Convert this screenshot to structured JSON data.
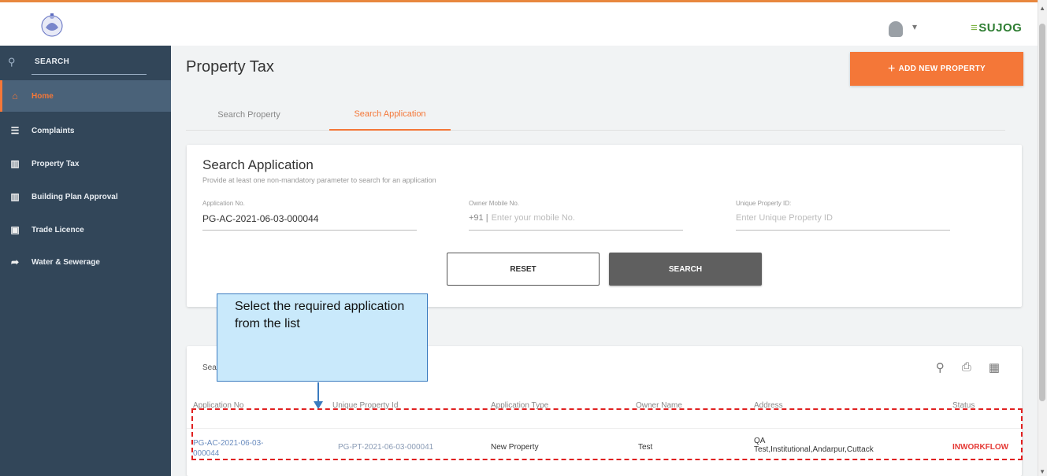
{
  "topbar": {
    "brand_prefix": "≡",
    "brand": "SUJOG",
    "user_caret": "▾",
    "logo_icon": "state-emblem-icon",
    "avatar_icon": "user-avatar-icon"
  },
  "sidebar": {
    "search_label": "SEARCH",
    "search_icon": "search-icon",
    "items": [
      {
        "label": "Home",
        "icon": "home-icon",
        "glyph": "⌂",
        "active": true
      },
      {
        "label": "Complaints",
        "icon": "complaints-icon",
        "glyph": "☰",
        "active": false
      },
      {
        "label": "Property Tax",
        "icon": "property-tax-icon",
        "glyph": "▥",
        "active": false
      },
      {
        "label": "Building Plan Approval",
        "icon": "building-icon",
        "glyph": "▥",
        "active": false
      },
      {
        "label": "Trade Licence",
        "icon": "trade-licence-icon",
        "glyph": "▣",
        "active": false
      },
      {
        "label": "Water & Sewerage",
        "icon": "water-icon",
        "glyph": "➦",
        "active": false
      }
    ],
    "colors": {
      "background": "#324659",
      "active": "#f47738"
    }
  },
  "main": {
    "title": "Property Tax",
    "add_button": "ADD NEW PROPERTY",
    "tabs": [
      {
        "label": "Search Property",
        "active": false
      },
      {
        "label": "Search Application",
        "active": true
      }
    ]
  },
  "search_card": {
    "title": "Search Application",
    "subtitle": "Provide at least one non-mandatory parameter to search for an application",
    "fields": {
      "application_no": {
        "label": "Application No.",
        "value": "PG-AC-2021-06-03-000044"
      },
      "owner_mobile": {
        "label": "Owner Mobile No.",
        "prefix": "+91 |",
        "placeholder": "Enter your mobile No."
      },
      "unique_property": {
        "label": "Unique Property ID:",
        "placeholder": "Enter Unique Property ID"
      }
    },
    "reset_button": "RESET",
    "search_button": "SEARCH"
  },
  "results": {
    "title": "Search Results",
    "icons": [
      "search-icon",
      "print-icon",
      "columns-icon"
    ],
    "columns": [
      "Application No",
      "Unique Property Id",
      "Application Type",
      "Owner Name",
      "Address",
      "Status"
    ],
    "rows": [
      {
        "application_no": "PG-AC-2021-06-03-000044",
        "property_id": "PG-PT-2021-06-03-000041",
        "type": "New Property",
        "owner": "Test",
        "address_line1": "QA",
        "address_line2": "Test,Institutional,Andarpur,Cuttack",
        "status": "INWORKFLOW"
      }
    ]
  },
  "annotation": {
    "callout_text": "Select the required application from the list",
    "colors": {
      "callout_bg": "#c9e9fb",
      "callout_border": "#3a7bbf",
      "highlight": "#e02020"
    }
  },
  "colors": {
    "accent": "#f47738",
    "brand": "#2e7d32",
    "status_error": "#e53935"
  }
}
